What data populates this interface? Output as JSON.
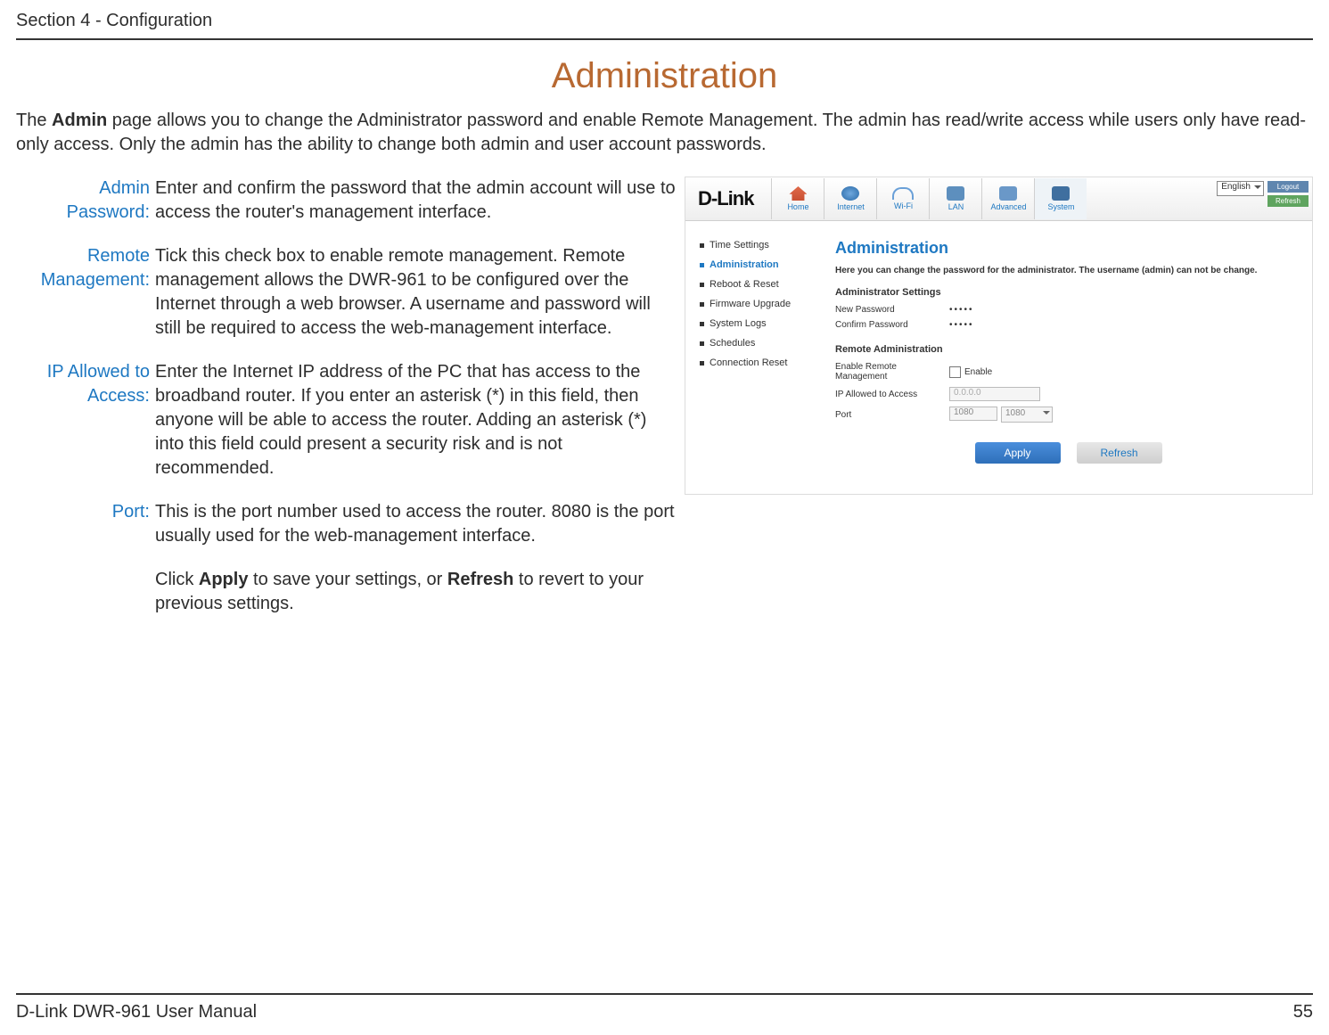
{
  "section_header": "Section 4 - Configuration",
  "page_title": "Administration",
  "intro_before_bold": "The ",
  "intro_bold": "Admin",
  "intro_after_bold": " page allows you to change the Administrator password and enable Remote Management. The admin has read/write access while users only have read-only access. Only the admin has the ability to change both admin and user account passwords.",
  "terms": {
    "admin_password": {
      "label": "Admin Password:",
      "desc": "Enter and confirm the password that the admin account will use to access the router's management interface."
    },
    "remote_mgmt": {
      "label": "Remote Management:",
      "desc": "Tick this check box to enable remote management. Remote management allows the DWR-961 to be configured over the Internet through a web browser. A username and password will still be required to access the web-management interface."
    },
    "ip_allowed": {
      "label": "IP Allowed to Access:",
      "desc": "Enter the Internet IP address of the PC that has access to the broadband router. If you enter an asterisk (*) in this field, then anyone will be able to access the router. Adding an asterisk (*) into this field could present a security risk and is not recommended."
    },
    "port": {
      "label": "Port:",
      "desc": "This is the port number used to access the router. 8080 is the port usually used for the web-management interface."
    },
    "note_prefix": "Click ",
    "note_b1": "Apply",
    "note_mid": " to save your settings, or ",
    "note_b2": "Refresh",
    "note_suffix": " to revert to your previous settings."
  },
  "shot": {
    "brand": "D-Link",
    "nav": {
      "home": "Home",
      "internet": "Internet",
      "wifi": "Wi-Fi",
      "lan": "LAN",
      "advanced": "Advanced",
      "system": "System"
    },
    "lang": "English",
    "logout": "Logout",
    "refresh_top": "Refresh",
    "side": {
      "time": "Time Settings",
      "admin": "Administration",
      "reboot": "Reboot & Reset",
      "fw": "Firmware Upgrade",
      "logs": "System Logs",
      "sched": "Schedules",
      "conn": "Connection Reset"
    },
    "heading": "Administration",
    "hint": "Here you can change the password for the administrator. The username (admin) can not be change.",
    "sect_admin": "Administrator Settings",
    "new_pw_label": "New Password",
    "confirm_pw_label": "Confirm Password",
    "pw_dots": "•••••",
    "sect_remote": "Remote Administration",
    "enable_remote_label": "Enable Remote Management",
    "enable_text": "Enable",
    "ip_label": "IP Allowed to Access",
    "ip_value": "0.0.0.0",
    "port_label": "Port",
    "port_value": "1080",
    "port_sel": "1080",
    "apply": "Apply",
    "refresh": "Refresh"
  },
  "footer_left": "D-Link DWR-961 User Manual",
  "footer_right": "55"
}
